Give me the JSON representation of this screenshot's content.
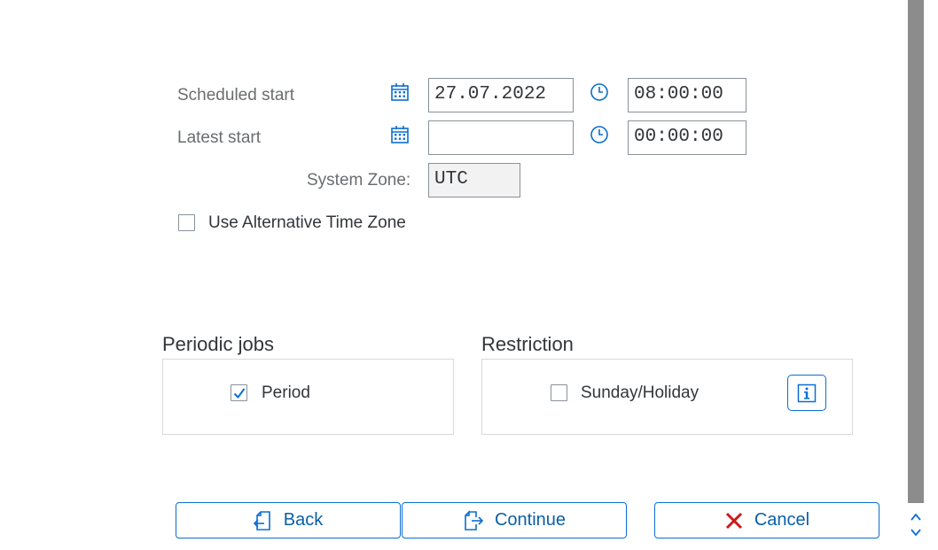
{
  "schedule": {
    "scheduled_start": {
      "label": "Scheduled start",
      "date": "27.07.2022",
      "time": "08:00:00"
    },
    "latest_start": {
      "label": "Latest start",
      "date": "",
      "time": "00:00:00"
    },
    "system_zone": {
      "label": "System Zone:",
      "value": "UTC"
    },
    "alt_time_zone": {
      "label": "Use Alternative Time Zone",
      "checked": false
    }
  },
  "periodic_jobs": {
    "title": "Periodic jobs",
    "period": {
      "label": "Period",
      "checked": true
    }
  },
  "restriction": {
    "title": "Restriction",
    "sunday_holiday": {
      "label": "Sunday/Holiday",
      "checked": false
    },
    "info_icon": "info-icon"
  },
  "buttons": {
    "back": {
      "label": "Back",
      "icon": "back-icon"
    },
    "continue": {
      "label": "Continue",
      "icon": "continue-icon"
    },
    "cancel": {
      "label": "Cancel",
      "icon": "close-icon"
    }
  },
  "colors": {
    "accent": "#0a6ed1",
    "cancel_red": "#cc1919",
    "scrollbar": "#8c8c8c"
  }
}
